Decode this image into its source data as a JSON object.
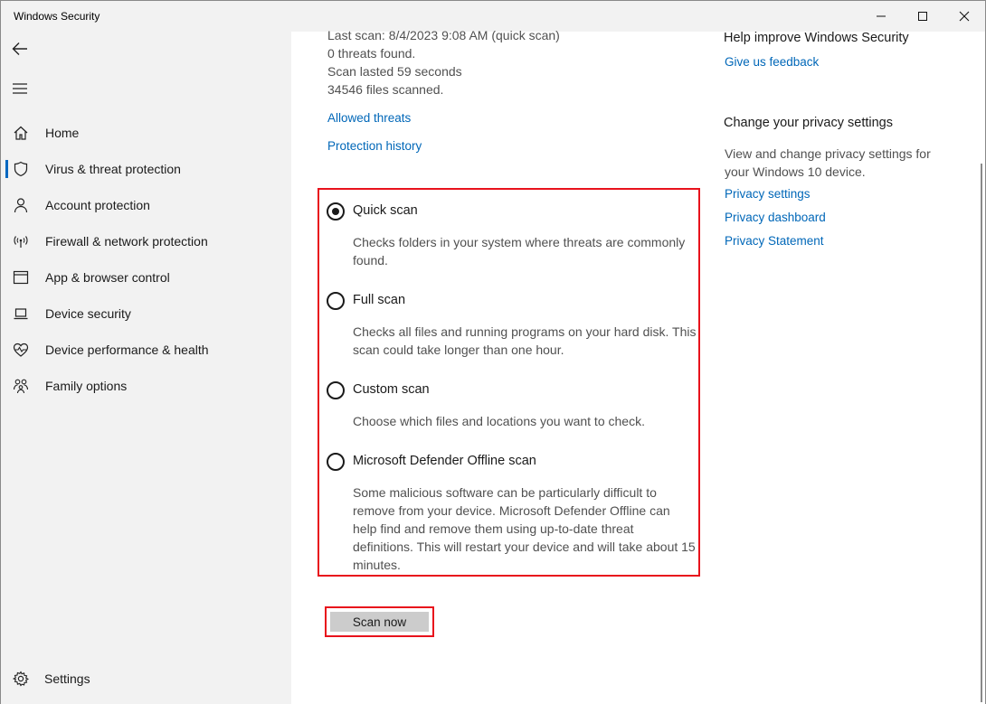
{
  "window": {
    "title": "Windows Security"
  },
  "sidebar": {
    "items": [
      {
        "label": "Home",
        "icon": "home-icon"
      },
      {
        "label": "Virus & threat protection",
        "icon": "shield-icon"
      },
      {
        "label": "Account protection",
        "icon": "person-icon"
      },
      {
        "label": "Firewall & network protection",
        "icon": "wireless-icon"
      },
      {
        "label": "App & browser control",
        "icon": "app-window-icon"
      },
      {
        "label": "Device security",
        "icon": "laptop-icon"
      },
      {
        "label": "Device performance & health",
        "icon": "heart-pulse-icon"
      },
      {
        "label": "Family options",
        "icon": "family-icon"
      }
    ],
    "active_item": "Virus & threat protection",
    "settings_label": "Settings"
  },
  "scan_info": {
    "last_scan": "Last scan: 8/4/2023 9:08 AM (quick scan)",
    "threats": "0 threats found.",
    "duration": "Scan lasted 59 seconds",
    "files": "34546 files scanned."
  },
  "links": {
    "allowed_threats": "Allowed threats",
    "protection_history": "Protection history"
  },
  "scan_options": [
    {
      "label": "Quick scan",
      "desc": "Checks folders in your system where threats are commonly found.",
      "selected": true
    },
    {
      "label": "Full scan",
      "desc": "Checks all files and running programs on your hard disk. This scan could take longer than one hour.",
      "selected": false
    },
    {
      "label": "Custom scan",
      "desc": "Choose which files and locations you want to check.",
      "selected": false
    },
    {
      "label": "Microsoft Defender Offline scan",
      "desc": "Some malicious software can be particularly difficult to remove from your device. Microsoft Defender Offline can help find and remove them using up-to-date threat definitions. This will restart your device and will take about 15 minutes.",
      "selected": false
    }
  ],
  "scan_button": "Scan now",
  "right": {
    "help_heading": "Help improve Windows Security",
    "feedback_link": "Give us feedback",
    "privacy_heading": "Change your privacy settings",
    "privacy_desc": "View and change privacy settings for your Windows 10 device.",
    "privacy_links": [
      "Privacy settings",
      "Privacy dashboard",
      "Privacy Statement"
    ]
  },
  "colors": {
    "accent": "#0067b8",
    "highlight": "#e8121c",
    "sidebar_bg": "#f2f2f2"
  }
}
